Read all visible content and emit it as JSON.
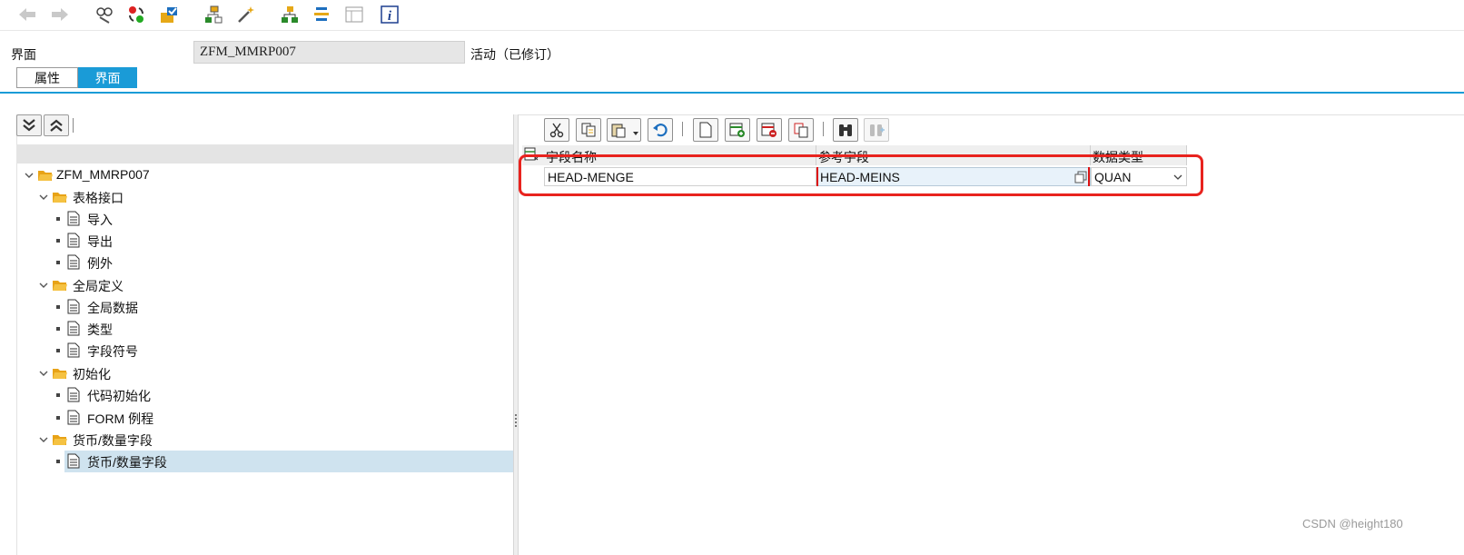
{
  "header": {
    "label": "界面",
    "value": "ZFM_MMRP007",
    "status": "活动（已修订）"
  },
  "tabs": [
    {
      "label": "属性"
    },
    {
      "label": "界面"
    }
  ],
  "tree": {
    "root": "ZFM_MMRP007",
    "items": [
      {
        "label": "表格接口"
      },
      {
        "label": "导入"
      },
      {
        "label": "导出"
      },
      {
        "label": "例外"
      },
      {
        "label": "全局定义"
      },
      {
        "label": "全局数据"
      },
      {
        "label": "类型"
      },
      {
        "label": "字段符号"
      },
      {
        "label": "初始化"
      },
      {
        "label": "代码初始化"
      },
      {
        "label": "FORM 例程"
      },
      {
        "label": "货币/数量字段"
      },
      {
        "label": "货币/数量字段"
      }
    ]
  },
  "grid": {
    "columns": [
      "字段名称",
      "参考字段",
      "数据类型"
    ],
    "rows": [
      {
        "field_name": "HEAD-MENGE",
        "ref_field": "HEAD-MEINS",
        "data_type": "QUAN"
      }
    ]
  },
  "watermark": "CSDN @height180",
  "colors": {
    "accent": "#1a9bd7",
    "highlight": "#e8231e",
    "selected_row": "#cfe3ef"
  }
}
